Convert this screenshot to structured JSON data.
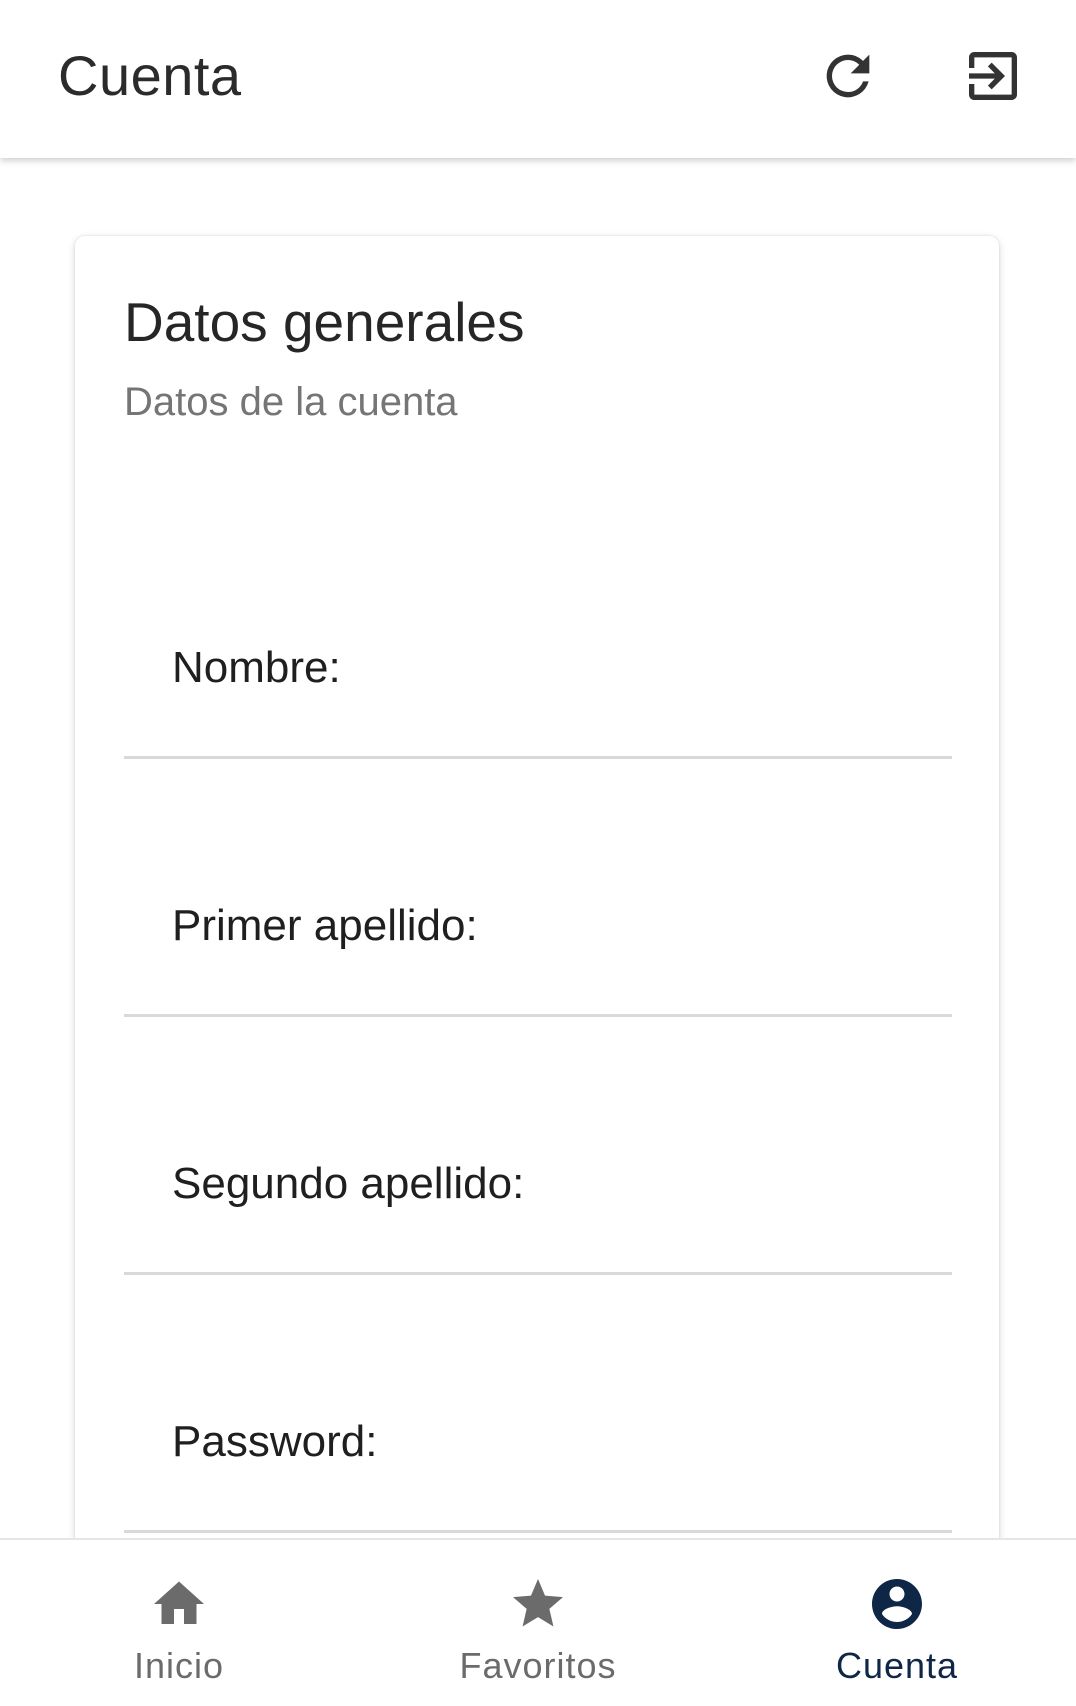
{
  "header": {
    "title": "Cuenta",
    "refresh_icon": "refresh-icon",
    "logout_icon": "logout-icon"
  },
  "card": {
    "title": "Datos generales",
    "subtitle": "Datos de la cuenta",
    "fields": [
      {
        "label": "Nombre:",
        "value": ""
      },
      {
        "label": "Primer apellido:",
        "value": ""
      },
      {
        "label": "Segundo apellido:",
        "value": ""
      },
      {
        "label": "Password:",
        "value": ""
      }
    ]
  },
  "bottom_nav": {
    "items": [
      {
        "label": "Inicio",
        "icon": "home-icon",
        "active": false
      },
      {
        "label": "Favoritos",
        "icon": "star-icon",
        "active": false
      },
      {
        "label": "Cuenta",
        "icon": "account-circle-icon",
        "active": true
      }
    ],
    "active_color": "#0f2746",
    "inactive_color": "#6b6b6b"
  }
}
